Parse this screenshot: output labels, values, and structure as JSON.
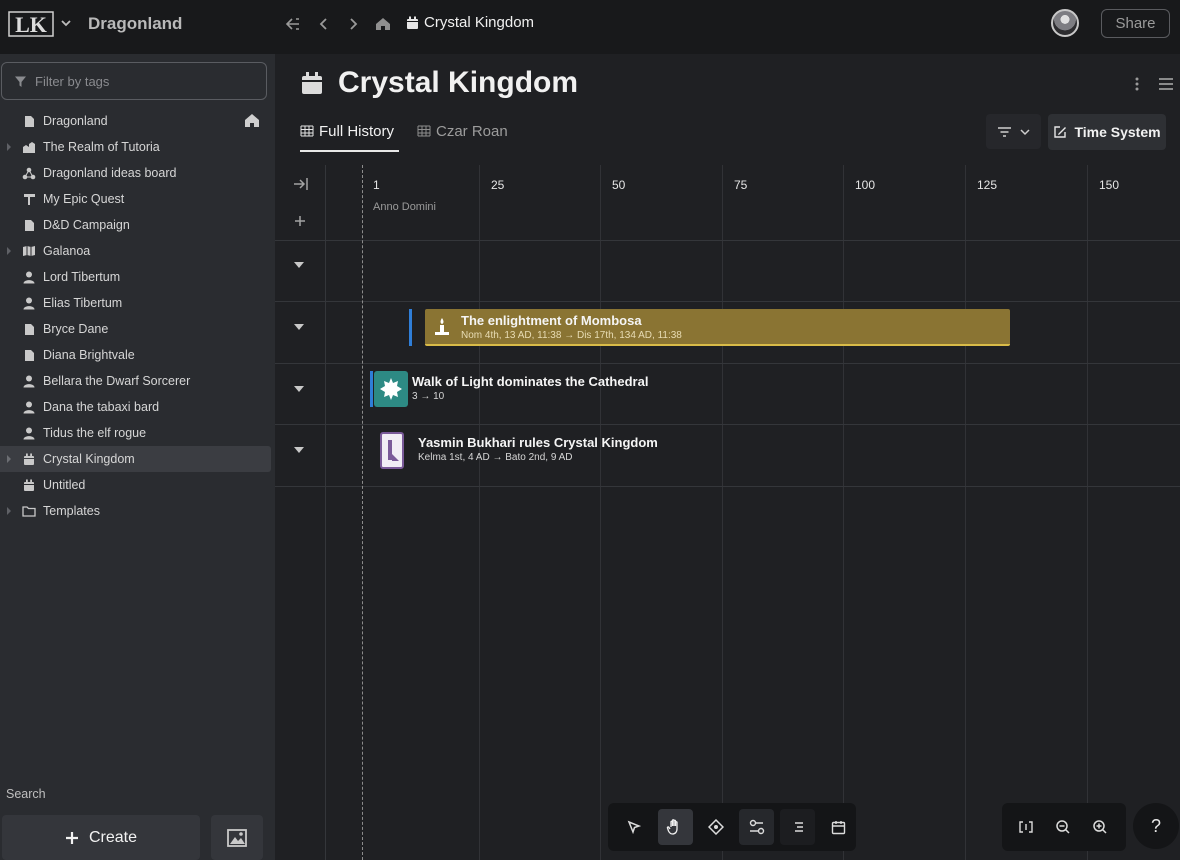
{
  "topbar": {
    "logo_text": "LK",
    "workspace_name": "Dragonland",
    "breadcrumb": "Crystal Kingdom",
    "share_label": "Share"
  },
  "sidebar": {
    "filter_placeholder": "Filter by tags",
    "items": [
      {
        "label": "Dragonland",
        "icon": "page-icon"
      },
      {
        "label": "The Realm of Tutoria",
        "icon": "buildings-icon"
      },
      {
        "label": "Dragonland ideas board",
        "icon": "board-icon"
      },
      {
        "label": "My Epic Quest",
        "icon": "quest-icon"
      },
      {
        "label": "D&D Campaign",
        "icon": "page-icon"
      },
      {
        "label": "Galanoa",
        "icon": "map-icon"
      },
      {
        "label": "Lord Tibertum",
        "icon": "person-icon"
      },
      {
        "label": "Elias Tibertum",
        "icon": "person-icon"
      },
      {
        "label": "Bryce Dane",
        "icon": "page-icon"
      },
      {
        "label": "Diana Brightvale",
        "icon": "page-icon"
      },
      {
        "label": "Bellara the Dwarf Sorcerer",
        "icon": "person-icon"
      },
      {
        "label": "Dana the tabaxi bard",
        "icon": "person-icon"
      },
      {
        "label": "Tidus the elf rogue",
        "icon": "person-icon"
      },
      {
        "label": "Crystal Kingdom",
        "icon": "calendar-icon"
      },
      {
        "label": "Untitled",
        "icon": "calendar-icon"
      },
      {
        "label": "Templates",
        "icon": "folder-icon"
      }
    ],
    "search_label": "Search",
    "create_label": "Create"
  },
  "page": {
    "title": "Crystal Kingdom",
    "tabs": [
      {
        "label": "Full History"
      },
      {
        "label": "Czar Roan"
      }
    ],
    "time_system_label": "Time System"
  },
  "timeline": {
    "ticks": [
      "1",
      "25",
      "50",
      "75",
      "100",
      "125",
      "150"
    ],
    "era_label": "Anno Domini",
    "events": [
      {
        "title": "The enlightment of Mombosa",
        "range": "Nom 4th, 13 AD, 11:38 → Dis 17th, 134 AD, 11:38",
        "color": "#8a7433"
      },
      {
        "title": "Walk of Light dominates the Cathedral",
        "range": "3 → 10",
        "color": "#2d8a84"
      },
      {
        "title": "Yasmin Bukhari rules Crystal Kingdom",
        "range": "Kelma 1st, 4 AD → Bato 2nd, 9 AD",
        "color": "#7a5a99"
      }
    ]
  },
  "help_label": "?"
}
